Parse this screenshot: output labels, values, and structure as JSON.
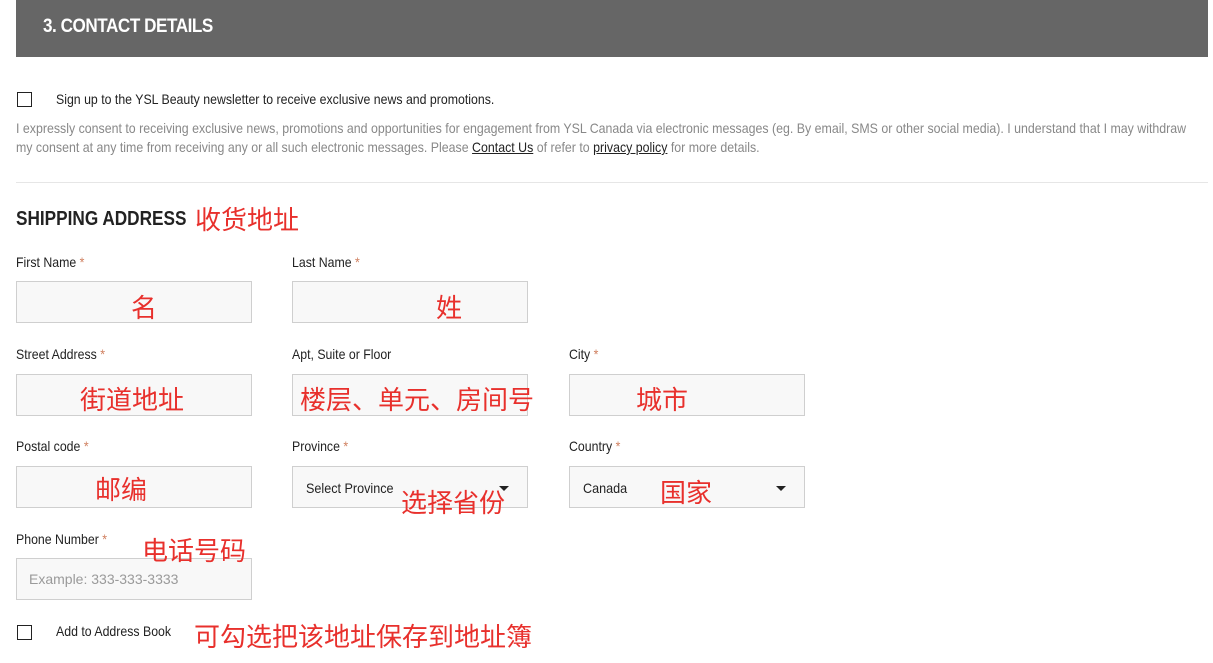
{
  "header": {
    "title": "3. CONTACT DETAILS"
  },
  "newsletter": {
    "label": "Sign up to the YSL Beauty newsletter to receive exclusive news and promotions."
  },
  "consent": {
    "text_before": "I expressly consent to receiving exclusive news, promotions and opportunities for engagement from YSL Canada via electronic messages (eg. By email, SMS or other social media). I understand that I may withdraw my consent at any time from receiving any or all such electronic messages. Please ",
    "contact_link": "Contact Us",
    "text_middle": " of refer to ",
    "privacy_link": "privacy policy",
    "text_after": " for more details."
  },
  "shipping": {
    "title": "SHIPPING ADDRESS",
    "first_name": {
      "label": "First Name",
      "value": ""
    },
    "last_name": {
      "label": "Last Name",
      "value": ""
    },
    "street": {
      "label": "Street Address",
      "value": ""
    },
    "apt": {
      "label": "Apt, Suite or Floor",
      "value": ""
    },
    "city": {
      "label": "City",
      "value": ""
    },
    "postal": {
      "label": "Postal code",
      "value": ""
    },
    "province": {
      "label": "Province",
      "selected": "Select Province"
    },
    "country": {
      "label": "Country",
      "selected": "Canada"
    },
    "phone": {
      "label": "Phone Number",
      "placeholder": "Example: 333-333-3333"
    },
    "address_book": {
      "label": "Add to Address Book"
    },
    "required_mark": "*"
  },
  "annotations": {
    "shipping_title": "收货地址",
    "first_name": "名",
    "last_name": "姓",
    "street": "街道地址",
    "apt": "楼层、单元、房间号",
    "city": "城市",
    "postal": "邮编",
    "province": "选择省份",
    "country": "国家",
    "phone": "电话号码",
    "address_book": "可勾选把该地址保存到地址簿"
  },
  "colors": {
    "header_bg": "#666666",
    "annotation": "#e8302c",
    "required": "#d08060"
  }
}
